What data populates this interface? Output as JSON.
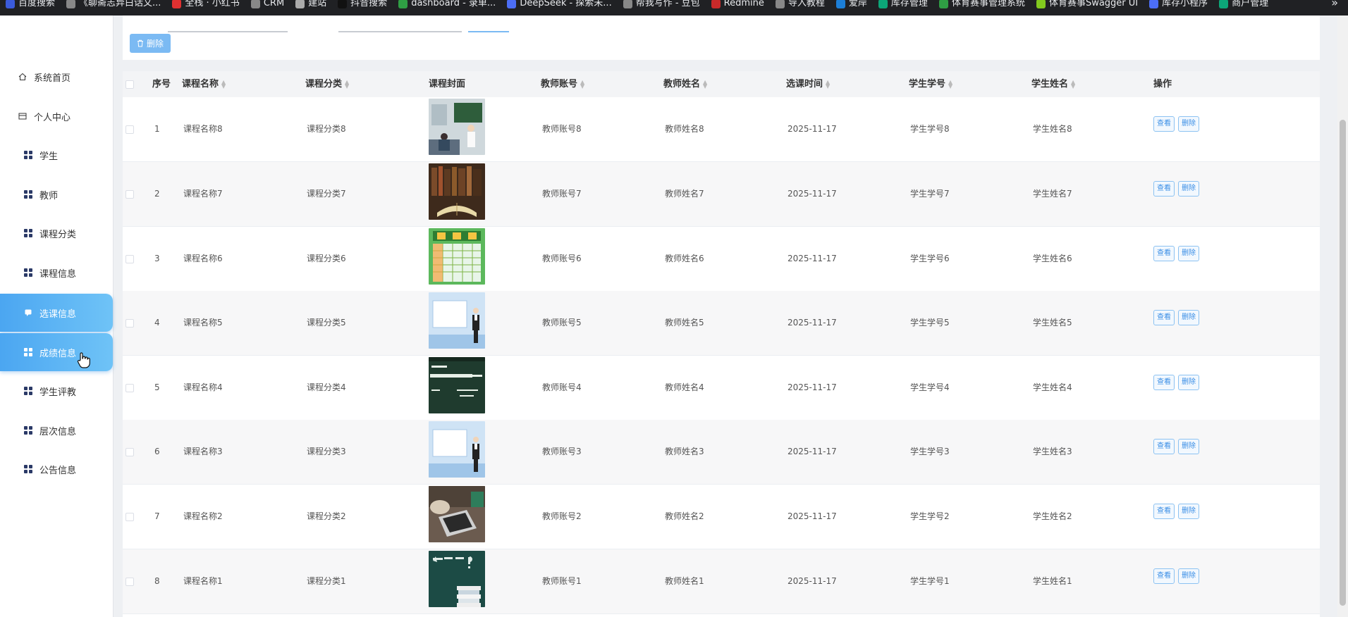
{
  "bookmarks": [
    {
      "label": "百度搜索",
      "color": "#3b5bdb"
    },
    {
      "label": "《聊斋志异白话文...",
      "color": "#888"
    },
    {
      "label": "全栈 · 小红书",
      "color": "#e03131"
    },
    {
      "label": "CRM",
      "color": "#888"
    },
    {
      "label": "建站",
      "color": "#aaa"
    },
    {
      "label": "抖音搜索",
      "color": "#111"
    },
    {
      "label": "dashboard - 录单...",
      "color": "#2f9e44"
    },
    {
      "label": "DeepSeek - 探索未...",
      "color": "#4c6ef5"
    },
    {
      "label": "帮我写作 - 豆包",
      "color": "#888"
    },
    {
      "label": "Redmine",
      "color": "#c92a2a"
    },
    {
      "label": "导入教程",
      "color": "#888"
    },
    {
      "label": "爱岸",
      "color": "#1c7ed6"
    },
    {
      "label": "库存管理",
      "color": "#0ca678"
    },
    {
      "label": "体育赛事管理系统",
      "color": "#2f9e44"
    },
    {
      "label": "体育赛事Swagger UI",
      "color": "#82c91e"
    },
    {
      "label": "库存小程序",
      "color": "#4c6ef5"
    },
    {
      "label": "商户管理",
      "color": "#0ca678"
    }
  ],
  "bookmarks_more": "»",
  "sidebar": {
    "items": [
      {
        "label": "系统首页",
        "icon": "home-icon",
        "active": false
      },
      {
        "label": "个人中心",
        "icon": "profile-icon",
        "active": false
      },
      {
        "label": "学生",
        "icon": "grid-icon",
        "active": false
      },
      {
        "label": "教师",
        "icon": "grid-icon",
        "active": false
      },
      {
        "label": "课程分类",
        "icon": "grid-icon",
        "active": false
      },
      {
        "label": "课程信息",
        "icon": "grid-icon",
        "active": false
      },
      {
        "label": "选课信息",
        "icon": "chat-icon",
        "active": true
      },
      {
        "label": "成绩信息",
        "icon": "grid-icon",
        "active": true
      },
      {
        "label": "学生评教",
        "icon": "grid-icon",
        "active": false
      },
      {
        "label": "层次信息",
        "icon": "grid-icon",
        "active": false
      },
      {
        "label": "公告信息",
        "icon": "grid-icon",
        "active": false
      }
    ]
  },
  "toolbar": {
    "delete_label": "删除"
  },
  "table": {
    "headers": [
      "序号",
      "课程名称",
      "课程分类",
      "课程封面",
      "教师账号",
      "教师姓名",
      "选课时间",
      "学生学号",
      "学生姓名",
      "操作"
    ],
    "view_label": "查看",
    "delete_label": "删除",
    "rows": [
      {
        "no": "1",
        "course": "课程名称8",
        "category": "课程分类8",
        "cover": "classroom",
        "teacher_acc": "教师账号8",
        "teacher_name": "教师姓名8",
        "time": "2025-11-17",
        "stu_no": "学生学号8",
        "stu_name": "学生姓名8"
      },
      {
        "no": "2",
        "course": "课程名称7",
        "category": "课程分类7",
        "cover": "books",
        "teacher_acc": "教师账号7",
        "teacher_name": "教师姓名7",
        "time": "2025-11-17",
        "stu_no": "学生学号7",
        "stu_name": "学生姓名7"
      },
      {
        "no": "3",
        "course": "课程名称6",
        "category": "课程分类6",
        "cover": "timetable",
        "teacher_acc": "教师账号6",
        "teacher_name": "教师姓名6",
        "time": "2025-11-17",
        "stu_no": "学生学号6",
        "stu_name": "学生姓名6"
      },
      {
        "no": "4",
        "course": "课程名称5",
        "category": "课程分类5",
        "cover": "presenter",
        "teacher_acc": "教师账号5",
        "teacher_name": "教师姓名5",
        "time": "2025-11-17",
        "stu_no": "学生学号5",
        "stu_name": "学生姓名5"
      },
      {
        "no": "5",
        "course": "课程名称4",
        "category": "课程分类4",
        "cover": "chalkboard",
        "teacher_acc": "教师账号4",
        "teacher_name": "教师姓名4",
        "time": "2025-11-17",
        "stu_no": "学生学号4",
        "stu_name": "学生姓名4"
      },
      {
        "no": "6",
        "course": "课程名称3",
        "category": "课程分类3",
        "cover": "presenter",
        "teacher_acc": "教师账号3",
        "teacher_name": "教师姓名3",
        "time": "2025-11-17",
        "stu_no": "学生学号3",
        "stu_name": "学生姓名3"
      },
      {
        "no": "7",
        "course": "课程名称2",
        "category": "课程分类2",
        "cover": "laptop",
        "teacher_acc": "教师账号2",
        "teacher_name": "教师姓名2",
        "time": "2025-11-17",
        "stu_no": "学生学号2",
        "stu_name": "学生姓名2"
      },
      {
        "no": "8",
        "course": "课程名称1",
        "category": "课程分类1",
        "cover": "classbegins",
        "teacher_acc": "教师账号1",
        "teacher_name": "教师姓名1",
        "time": "2025-11-17",
        "stu_no": "学生学号1",
        "stu_name": "学生姓名1"
      }
    ]
  },
  "colors": {
    "accent": "#4ba6f1",
    "button": "#7bbaf3",
    "nav_icon": "#2b3a67"
  }
}
